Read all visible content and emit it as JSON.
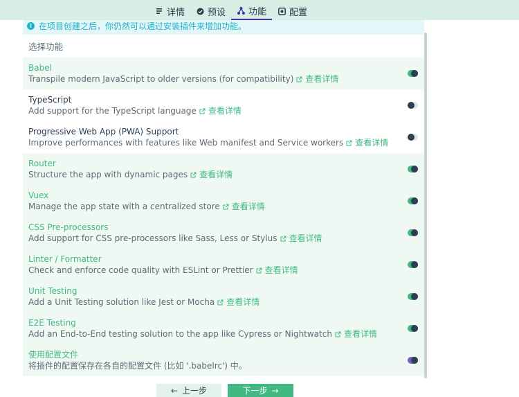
{
  "tabs": [
    {
      "label": "详情",
      "icon": "details-icon"
    },
    {
      "label": "预设",
      "icon": "preset-icon"
    },
    {
      "label": "功能",
      "icon": "features-icon",
      "active": true
    },
    {
      "label": "配置",
      "icon": "config-icon"
    }
  ],
  "notice": "在项目创建之后，你仍然可以通过安装插件来增加功能。",
  "section_title": "选择功能",
  "more_label": "查看详情",
  "features": [
    {
      "name": "Babel",
      "desc": "Transpile modern JavaScript to older versions (for compatibility)",
      "enabled": true
    },
    {
      "name": "TypeScript",
      "desc": "Add support for the TypeScript language",
      "enabled": false
    },
    {
      "name": "Progressive Web App (PWA) Support",
      "desc": "Improve performances with features like Web manifest and Service workers",
      "enabled": false
    },
    {
      "name": "Router",
      "desc": "Structure the app with dynamic pages",
      "enabled": true
    },
    {
      "name": "Vuex",
      "desc": "Manage the app state with a centralized store",
      "enabled": true
    },
    {
      "name": "CSS Pre-processors",
      "desc": "Add support for CSS pre-processors like Sass, Less or Stylus",
      "enabled": true
    },
    {
      "name": "Linter / Formatter",
      "desc": "Check and enforce code quality with ESLint or Prettier",
      "enabled": true
    },
    {
      "name": "Unit Testing",
      "desc": "Add a Unit Testing solution like Jest or Mocha",
      "enabled": true
    },
    {
      "name": "E2E Testing",
      "desc": "Add an End-to-End testing solution to the app like Cypress or Nightwatch",
      "enabled": true
    }
  ],
  "config_option": {
    "name": "使用配置文件",
    "desc": "将插件的配置保存在各自的配置文件 (比如 '.babelrc') 中。",
    "enabled": true
  },
  "buttons": {
    "prev": "上一步",
    "next": "下一步"
  },
  "colors": {
    "accent": "#42b983",
    "active_tab": "#4b2da8",
    "info": "#20b0c9",
    "topbar": "#d6eee4"
  }
}
